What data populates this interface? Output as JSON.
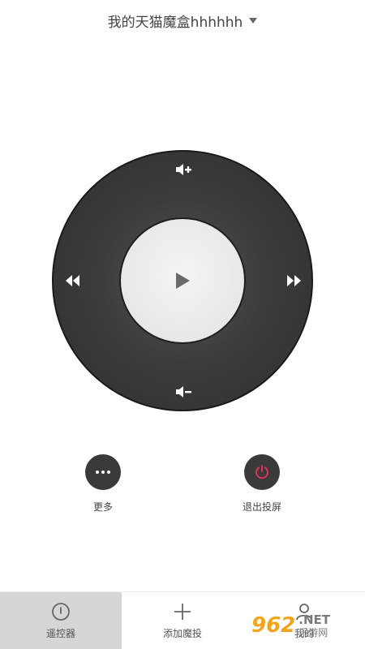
{
  "header": {
    "device_title": "我的天猫魔盒hhhhhh"
  },
  "remote": {
    "vol_up_icon": "volume-up-icon",
    "vol_down_icon": "volume-down-icon",
    "rewind_icon": "rewind-icon",
    "forward_icon": "fast-forward-icon",
    "center_icon": "play-icon"
  },
  "actions": [
    {
      "label": "更多",
      "icon": "more-dots-icon"
    },
    {
      "label": "退出投屏",
      "icon": "power-icon",
      "icon_color": "#e0325a"
    }
  ],
  "tabs": [
    {
      "label": "遥控器",
      "icon": "remote-icon",
      "active": true
    },
    {
      "label": "添加魔投",
      "icon": "plus-icon",
      "active": false
    },
    {
      "label": "我的",
      "icon": "user-icon",
      "active": false
    }
  ],
  "watermark": {
    "digits": "962",
    "net": ".NET",
    "sub": "乐游网"
  },
  "colors": {
    "ring": "#3c3c3c",
    "center": "#e8e8e8",
    "accent_power": "#e0325a",
    "active_tab": "#d6d6d6"
  }
}
